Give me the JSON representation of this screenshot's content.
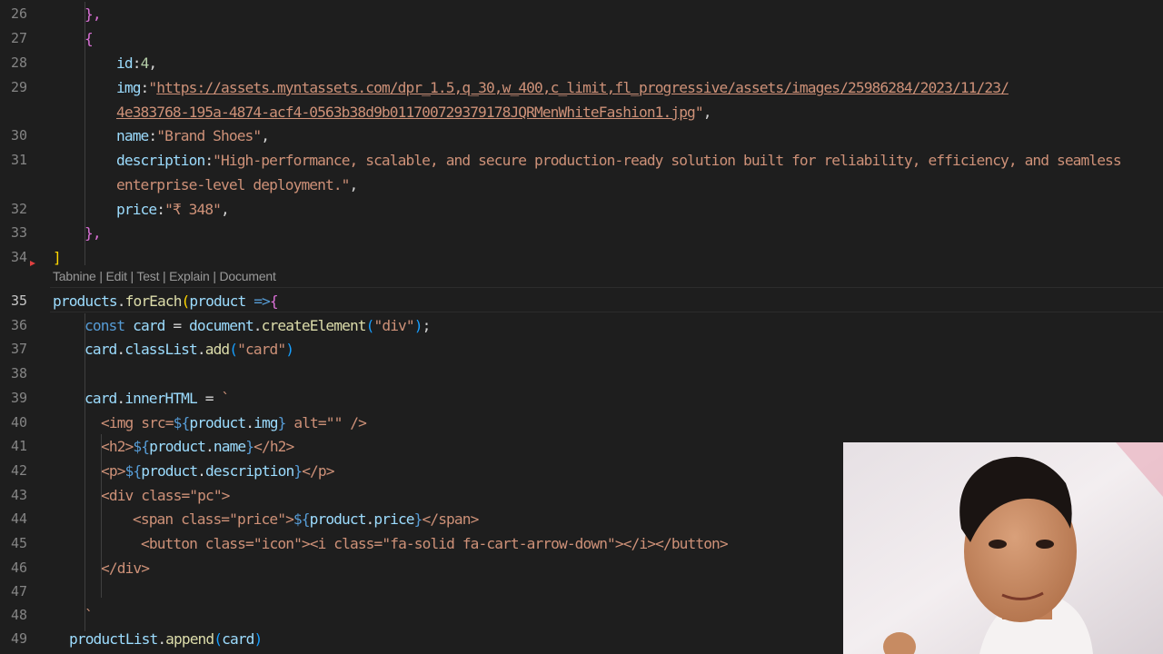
{
  "editor": {
    "lines": [
      {
        "n": "26",
        "tokens": [
          [
            "t-br2",
            "},"
          ]
        ]
      },
      {
        "n": "27",
        "tokens": [
          [
            "t-br2",
            "{"
          ]
        ]
      },
      {
        "n": "28",
        "tokens": [
          [
            "t-var",
            "id"
          ],
          [
            "t-plain",
            ":"
          ],
          [
            "t-num",
            "4"
          ],
          [
            "t-plain",
            ","
          ]
        ]
      },
      {
        "n": "29",
        "tokens": [
          [
            "t-var",
            "img"
          ],
          [
            "t-plain",
            ":"
          ],
          [
            "t-str",
            "\""
          ],
          [
            "t-str t-link",
            "https://assets.myntassets.com/dpr_1.5,q_30,w_400,c_limit,fl_progressive/assets/images/25986284/2023/11/23/"
          ]
        ]
      },
      {
        "n": "",
        "tokens": [
          [
            "t-str t-link",
            "4e383768-195a-4874-acf4-0563b38d9b0117007293791​78JQRMenWhiteFashion1.jpg"
          ],
          [
            "t-str",
            "\""
          ],
          [
            "t-plain",
            ","
          ]
        ]
      },
      {
        "n": "30",
        "tokens": [
          [
            "t-var",
            "name"
          ],
          [
            "t-plain",
            ":"
          ],
          [
            "t-str",
            "\"Brand Shoes\""
          ],
          [
            "t-plain",
            ","
          ]
        ]
      },
      {
        "n": "31",
        "tokens": [
          [
            "t-var",
            "description"
          ],
          [
            "t-plain",
            ":"
          ],
          [
            "t-str",
            "\"High-performance, scalable, and secure production-ready solution built for reliability, efficiency, and seamless"
          ]
        ]
      },
      {
        "n": "",
        "tokens": [
          [
            "t-str",
            "enterprise-level deployment.\""
          ],
          [
            "t-plain",
            ","
          ]
        ]
      },
      {
        "n": "32",
        "tokens": [
          [
            "t-var",
            "price"
          ],
          [
            "t-plain",
            ":"
          ],
          [
            "t-str",
            "\"₹ 348\""
          ],
          [
            "t-plain",
            ","
          ]
        ]
      },
      {
        "n": "33",
        "tokens": [
          [
            "t-br2",
            "},"
          ]
        ]
      },
      {
        "n": "34",
        "tokens": [
          [
            "t-br1",
            "]"
          ]
        ]
      },
      {
        "n": "35",
        "tokens": [
          [
            "t-var",
            "products"
          ],
          [
            "t-plain",
            "."
          ],
          [
            "t-fn",
            "forEach"
          ],
          [
            "t-br1",
            "("
          ],
          [
            "t-var",
            "product"
          ],
          [
            "t-plain",
            " "
          ],
          [
            "t-kw",
            "=>"
          ],
          [
            "t-br2",
            "{"
          ]
        ]
      },
      {
        "n": "36",
        "tokens": [
          [
            "t-kw",
            "const"
          ],
          [
            "t-plain",
            " "
          ],
          [
            "t-var",
            "card"
          ],
          [
            "t-plain",
            " = "
          ],
          [
            "t-var",
            "document"
          ],
          [
            "t-plain",
            "."
          ],
          [
            "t-fn",
            "createElement"
          ],
          [
            "t-br3",
            "("
          ],
          [
            "t-str",
            "\"div\""
          ],
          [
            "t-br3",
            ")"
          ],
          [
            "t-plain",
            ";"
          ]
        ]
      },
      {
        "n": "37",
        "tokens": [
          [
            "t-var",
            "card"
          ],
          [
            "t-plain",
            "."
          ],
          [
            "t-var",
            "classList"
          ],
          [
            "t-plain",
            "."
          ],
          [
            "t-fn",
            "add"
          ],
          [
            "t-br3",
            "("
          ],
          [
            "t-str",
            "\"card\""
          ],
          [
            "t-br3",
            ")"
          ]
        ]
      },
      {
        "n": "38",
        "tokens": []
      },
      {
        "n": "39",
        "tokens": [
          [
            "t-var",
            "card"
          ],
          [
            "t-plain",
            "."
          ],
          [
            "t-var",
            "innerHTML"
          ],
          [
            "t-plain",
            " = "
          ],
          [
            "t-str",
            "`"
          ]
        ]
      },
      {
        "n": "40",
        "tokens": [
          [
            "t-tmpl",
            "<img src="
          ],
          [
            "t-interp",
            "${"
          ],
          [
            "t-var",
            "product"
          ],
          [
            "t-plain",
            "."
          ],
          [
            "t-var",
            "img"
          ],
          [
            "t-interp",
            "}"
          ],
          [
            "t-tmpl",
            " alt=\"\" />"
          ]
        ]
      },
      {
        "n": "41",
        "tokens": [
          [
            "t-tmpl",
            "<h2>"
          ],
          [
            "t-interp",
            "${"
          ],
          [
            "t-var",
            "product"
          ],
          [
            "t-plain",
            "."
          ],
          [
            "t-var",
            "name"
          ],
          [
            "t-interp",
            "}"
          ],
          [
            "t-tmpl",
            "</h2>"
          ]
        ]
      },
      {
        "n": "42",
        "tokens": [
          [
            "t-tmpl",
            "<p>"
          ],
          [
            "t-interp",
            "${"
          ],
          [
            "t-var",
            "product"
          ],
          [
            "t-plain",
            "."
          ],
          [
            "t-var",
            "description"
          ],
          [
            "t-interp",
            "}"
          ],
          [
            "t-tmpl",
            "</p>"
          ]
        ]
      },
      {
        "n": "43",
        "tokens": [
          [
            "t-tmpl",
            "<div class=\"pc\">"
          ]
        ]
      },
      {
        "n": "44",
        "tokens": [
          [
            "t-tmpl",
            "<span class=\"price\">"
          ],
          [
            "t-interp",
            "${"
          ],
          [
            "t-var",
            "product"
          ],
          [
            "t-plain",
            "."
          ],
          [
            "t-var",
            "price"
          ],
          [
            "t-interp",
            "}"
          ],
          [
            "t-tmpl",
            "</span>"
          ]
        ]
      },
      {
        "n": "45",
        "tokens": [
          [
            "t-tmpl",
            "<button class=\"icon\"><i class=\"fa-solid fa-cart-arrow-down\"></i></button>"
          ]
        ]
      },
      {
        "n": "46",
        "tokens": [
          [
            "t-tmpl",
            "</div>"
          ]
        ]
      },
      {
        "n": "47",
        "tokens": []
      },
      {
        "n": "48",
        "tokens": [
          [
            "t-str",
            "`"
          ]
        ]
      },
      {
        "n": "49",
        "tokens": [
          [
            "t-var",
            "productList"
          ],
          [
            "t-plain",
            "."
          ],
          [
            "t-fn",
            "append"
          ],
          [
            "t-br3",
            "("
          ],
          [
            "t-var",
            "card"
          ],
          [
            "t-br3",
            ")"
          ]
        ]
      }
    ],
    "active_line": "35",
    "codelens": [
      "Tabnine",
      "Edit",
      "Test",
      "Explain",
      "Document"
    ]
  },
  "colors": {
    "background": "#1e1e1e",
    "string": "#ce9178",
    "variable": "#9cdcfe",
    "keyword": "#569cd6",
    "function": "#dcdcaa"
  }
}
